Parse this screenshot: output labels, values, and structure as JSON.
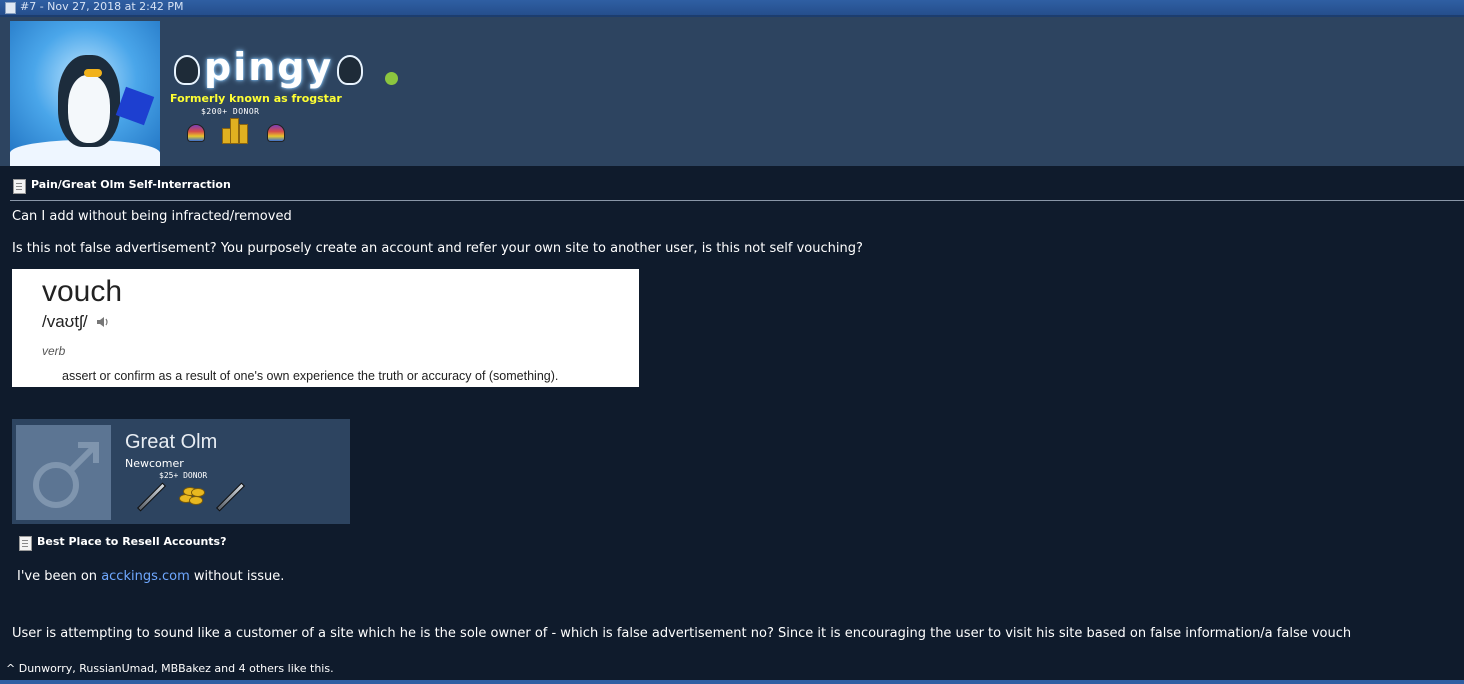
{
  "post_header": {
    "timestamp": "#7 - Nov 27, 2018 at 2:42 PM"
  },
  "author": {
    "display_name": "pingy",
    "status_text": "Formerly known as frogstar",
    "donor_badge": "$200+ DONOR",
    "online_color": "#8cc63f",
    "username_color": "#ffffff",
    "status_color": "#ffff33"
  },
  "post": {
    "quoted_thread_title": "Pain/Great Olm Self-Interraction",
    "line1": "Can I add without being infracted/removed",
    "line2": "Is this not false advertisement? You purposely create an account and refer your own site to another user, is this not self vouching?",
    "dictionary": {
      "word": "vouch",
      "pronunciation": "/vaʊtʃ/",
      "part_of_speech": "verb",
      "definition": "assert or confirm as a result of one's own experience the truth or accuracy of (something)."
    },
    "quote_user": {
      "name": "Great Olm",
      "rank": "Newcomer",
      "donor_badge": "$25+ DONOR"
    },
    "second_thread_title": "Best Place to Resell Accounts?",
    "quote_text_before": "I've been on ",
    "quote_link": "acckings.com",
    "quote_text_after": " without issue.",
    "line3": "User is attempting to sound like a customer of a site which he is the sole owner of - which is false advertisement no? Since it is encouraging the user to visit his site based on false information/a false vouch"
  },
  "likes": {
    "caret": "^",
    "users": [
      "Dunworry",
      "RussianUmad",
      "MBBakez"
    ],
    "sep1": ", ",
    "sep2": ", ",
    "and_text": " and ",
    "others": "4 others",
    "suffix": " like this."
  },
  "colors": {
    "background": "#0f1b2c",
    "header_band": "#2d4460",
    "link": "#6fa8ff"
  }
}
